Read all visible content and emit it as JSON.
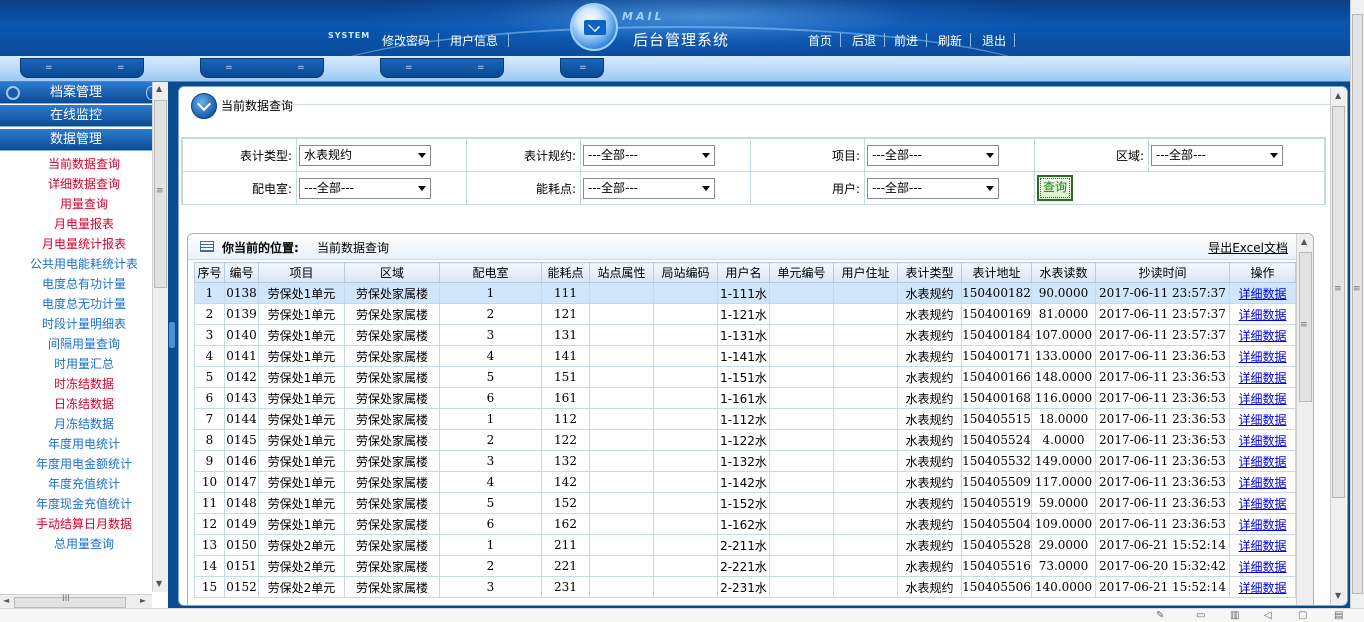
{
  "header": {
    "system_logo": "SYSTEM",
    "mail_word": "MAIL",
    "title": "后台管理系统",
    "left_links": [
      "修改密码",
      "用户信息"
    ],
    "right_links": [
      "首页",
      "后退",
      "前进",
      "刷新",
      "退出"
    ]
  },
  "subbar": {
    "dot": "="
  },
  "sidebar": {
    "sections": [
      "档案管理",
      "在线监控",
      "数据管理"
    ],
    "items": [
      {
        "label": "当前数据查询",
        "color": "red"
      },
      {
        "label": "详细数据查询",
        "color": "red"
      },
      {
        "label": "用量查询",
        "color": "red"
      },
      {
        "label": "月电量报表",
        "color": "red"
      },
      {
        "label": "月电量统计报表",
        "color": "red"
      },
      {
        "label": "公共用电能耗统计表",
        "color": "blue"
      },
      {
        "label": "电度总有功计量",
        "color": "blue"
      },
      {
        "label": "电度总无功计量",
        "color": "blue"
      },
      {
        "label": "时段计量明细表",
        "color": "blue"
      },
      {
        "label": "间隔用量查询",
        "color": "blue"
      },
      {
        "label": "时用量汇总",
        "color": "blue"
      },
      {
        "label": "时冻结数据",
        "color": "red"
      },
      {
        "label": "日冻结数据",
        "color": "red"
      },
      {
        "label": "月冻结数据",
        "color": "blue"
      },
      {
        "label": "年度用电统计",
        "color": "blue"
      },
      {
        "label": "年度用电金额统计",
        "color": "blue"
      },
      {
        "label": "年度充值统计",
        "color": "blue"
      },
      {
        "label": "年度现金充值统计",
        "color": "blue"
      },
      {
        "label": "手动结算日月数据",
        "color": "red"
      },
      {
        "label": "总用量查询",
        "color": "blue"
      }
    ]
  },
  "page": {
    "title": "当前数据查询"
  },
  "filter": {
    "row1": [
      {
        "label": "表计类型:",
        "value": "水表规约"
      },
      {
        "label": "表计规约:",
        "value": "---全部---"
      },
      {
        "label": "项目:",
        "value": "---全部---"
      },
      {
        "label": "区域:",
        "value": "---全部---"
      }
    ],
    "row2": [
      {
        "label": "配电室:",
        "value": "---全部---"
      },
      {
        "label": "能耗点:",
        "value": "---全部---"
      },
      {
        "label": "用户:",
        "value": "---全部---"
      }
    ],
    "query_label": "查询"
  },
  "results": {
    "location_label": "你当前的位置:",
    "location_value": "当前数据查询",
    "export_label": "导出Excel文档",
    "columns": [
      "序号",
      "编号",
      "项目",
      "区域",
      "配电室",
      "能耗点",
      "站点属性",
      "局站编码",
      "用户名",
      "单元编号",
      "用户住址",
      "表计类型",
      "表计地址",
      "水表读数",
      "抄读时间",
      "操作"
    ],
    "action_label": "详细数据",
    "rows": [
      [
        "1",
        "0138",
        "劳保处1单元",
        "劳保处家属楼",
        "1",
        "111",
        "",
        "",
        "1-111水",
        "",
        "",
        "水表规约",
        "150400182",
        "90.0000",
        "2017-06-11 23:57:37"
      ],
      [
        "2",
        "0139",
        "劳保处1单元",
        "劳保处家属楼",
        "2",
        "121",
        "",
        "",
        "1-121水",
        "",
        "",
        "水表规约",
        "150400169",
        "81.0000",
        "2017-06-11 23:57:37"
      ],
      [
        "3",
        "0140",
        "劳保处1单元",
        "劳保处家属楼",
        "3",
        "131",
        "",
        "",
        "1-131水",
        "",
        "",
        "水表规约",
        "150400184",
        "107.0000",
        "2017-06-11 23:57:37"
      ],
      [
        "4",
        "0141",
        "劳保处1单元",
        "劳保处家属楼",
        "4",
        "141",
        "",
        "",
        "1-141水",
        "",
        "",
        "水表规约",
        "150400171",
        "133.0000",
        "2017-06-11 23:36:53"
      ],
      [
        "5",
        "0142",
        "劳保处1单元",
        "劳保处家属楼",
        "5",
        "151",
        "",
        "",
        "1-151水",
        "",
        "",
        "水表规约",
        "150400166",
        "148.0000",
        "2017-06-11 23:36:53"
      ],
      [
        "6",
        "0143",
        "劳保处1单元",
        "劳保处家属楼",
        "6",
        "161",
        "",
        "",
        "1-161水",
        "",
        "",
        "水表规约",
        "150400168",
        "116.0000",
        "2017-06-11 23:36:53"
      ],
      [
        "7",
        "0144",
        "劳保处1单元",
        "劳保处家属楼",
        "1",
        "112",
        "",
        "",
        "1-112水",
        "",
        "",
        "水表规约",
        "150405515",
        "18.0000",
        "2017-06-11 23:36:53"
      ],
      [
        "8",
        "0145",
        "劳保处1单元",
        "劳保处家属楼",
        "2",
        "122",
        "",
        "",
        "1-122水",
        "",
        "",
        "水表规约",
        "150405524",
        "4.0000",
        "2017-06-11 23:36:53"
      ],
      [
        "9",
        "0146",
        "劳保处1单元",
        "劳保处家属楼",
        "3",
        "132",
        "",
        "",
        "1-132水",
        "",
        "",
        "水表规约",
        "150405532",
        "149.0000",
        "2017-06-11 23:36:53"
      ],
      [
        "10",
        "0147",
        "劳保处1单元",
        "劳保处家属楼",
        "4",
        "142",
        "",
        "",
        "1-142水",
        "",
        "",
        "水表规约",
        "150405509",
        "117.0000",
        "2017-06-11 23:36:53"
      ],
      [
        "11",
        "0148",
        "劳保处1单元",
        "劳保处家属楼",
        "5",
        "152",
        "",
        "",
        "1-152水",
        "",
        "",
        "水表规约",
        "150405519",
        "59.0000",
        "2017-06-11 23:36:53"
      ],
      [
        "12",
        "0149",
        "劳保处1单元",
        "劳保处家属楼",
        "6",
        "162",
        "",
        "",
        "1-162水",
        "",
        "",
        "水表规约",
        "150405504",
        "109.0000",
        "2017-06-11 23:36:53"
      ],
      [
        "13",
        "0150",
        "劳保处2单元",
        "劳保处家属楼",
        "1",
        "211",
        "",
        "",
        "2-211水",
        "",
        "",
        "水表规约",
        "150405528",
        "29.0000",
        "2017-06-21 15:52:14"
      ],
      [
        "14",
        "0151",
        "劳保处2单元",
        "劳保处家属楼",
        "2",
        "221",
        "",
        "",
        "2-221水",
        "",
        "",
        "水表规约",
        "150405516",
        "73.0000",
        "2017-06-20 15:32:42"
      ],
      [
        "15",
        "0152",
        "劳保处2单元",
        "劳保处家属楼",
        "3",
        "231",
        "",
        "",
        "2-231水",
        "",
        "",
        "水表规约",
        "150405506",
        "140.0000",
        "2017-06-21 15:52:14"
      ]
    ]
  },
  "scrollbars": {
    "grip": "≡",
    "hgrip": "III",
    "up": "▲",
    "down": "▼",
    "left": "◄",
    "right": "►"
  },
  "colors": {
    "header_dark": "#0b3f85",
    "menu_blue": "#1a6fcf",
    "menu_red": "#d9002b",
    "selected_row": "#cfe6fb"
  }
}
